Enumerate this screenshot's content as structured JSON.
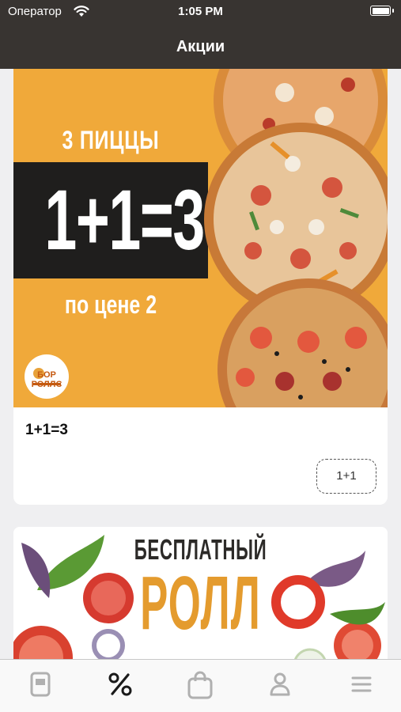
{
  "status_bar": {
    "carrier": "Оператор",
    "time": "1:05 PM",
    "battery_level": 1.0
  },
  "nav": {
    "title": "Акции"
  },
  "promos": [
    {
      "banner": {
        "line1": "3 ПИЦЦЫ",
        "big": "1+1=3",
        "line3": "по цене 2",
        "logo_text": "БОР РОЛЛС"
      },
      "title": "1+1=3",
      "tag": "1+1"
    },
    {
      "banner": {
        "line1": "БЕСПЛАТНЫЙ",
        "line2": "РОЛЛ"
      }
    }
  ],
  "tabs": [
    {
      "icon": "menu-icon",
      "active": false
    },
    {
      "icon": "percent-icon",
      "active": true
    },
    {
      "icon": "bag-icon",
      "active": false
    },
    {
      "icon": "profile-icon",
      "active": false
    },
    {
      "icon": "more-icon",
      "active": false
    }
  ],
  "colors": {
    "bar_bg": "#383431",
    "banner_orange": "#f0a93a",
    "tab_active": "#1a1a1a",
    "tab_inactive": "#b0b0b0",
    "roll_orange": "#e49b2e"
  }
}
